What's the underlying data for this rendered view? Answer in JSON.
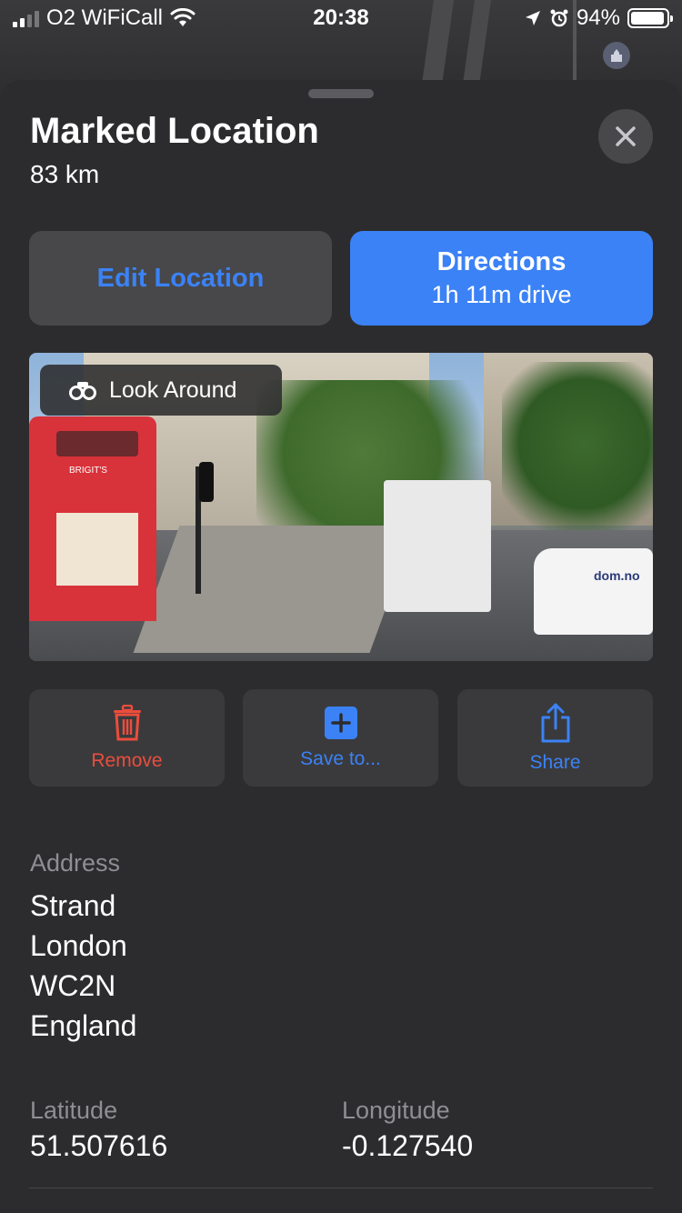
{
  "status_bar": {
    "carrier": "O2 WiFiCall",
    "time": "20:38",
    "battery": "94%",
    "battery_level": 0.94
  },
  "sheet": {
    "title": "Marked Location",
    "distance": "83 km"
  },
  "buttons": {
    "edit_location": "Edit Location",
    "directions_title": "Directions",
    "directions_subtitle": "1h 11m drive"
  },
  "look_around": {
    "label": "Look Around",
    "bus_sign": "BRIGIT'S",
    "vehicle_sign": "dom.no"
  },
  "actions": [
    {
      "label": "Remove",
      "icon": "trash-icon"
    },
    {
      "label": "Save to...",
      "icon": "plus-square-icon"
    },
    {
      "label": "Share",
      "icon": "share-icon"
    }
  ],
  "address": {
    "label": "Address",
    "lines": [
      "Strand",
      "London",
      "WC2N",
      "England"
    ]
  },
  "coordinates": {
    "latitude_label": "Latitude",
    "latitude": "51.507616",
    "longitude_label": "Longitude",
    "longitude": "-0.127540"
  },
  "colors": {
    "accent": "#3b82f6",
    "destructive": "#eb4d3d",
    "sheet_bg": "#2c2c2e"
  }
}
